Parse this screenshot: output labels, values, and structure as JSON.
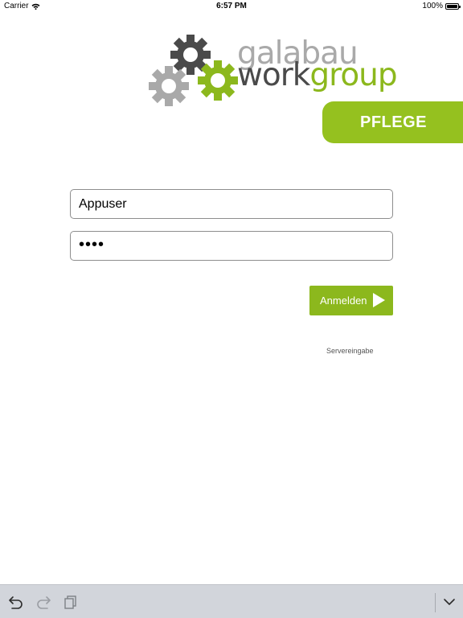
{
  "status_bar": {
    "carrier": "Carrier",
    "time": "6:57 PM",
    "battery": "100%",
    "battery_level": 1.0,
    "wifi_icon": "wifi-icon"
  },
  "logo": {
    "line1": "galabau",
    "line2_dark": "work",
    "line2_green": "group",
    "icon": "gears-logo-icon"
  },
  "badge": {
    "label": "PFLEGE"
  },
  "form": {
    "username_value": "Appuser",
    "password_dots": "••••",
    "login_label": "Anmelden",
    "server_link": "Servereingabe"
  },
  "keyboard_bar": {
    "undo_icon": "undo-icon",
    "redo_icon": "redo-icon",
    "paste_icon": "paste-icon",
    "dismiss_icon": "chevron-down-icon"
  },
  "colors": {
    "brand_green": "#95c11f",
    "button_green": "#8cb81d",
    "logo_gray": "#a9a9a9",
    "logo_dark": "#4a4a4a"
  }
}
